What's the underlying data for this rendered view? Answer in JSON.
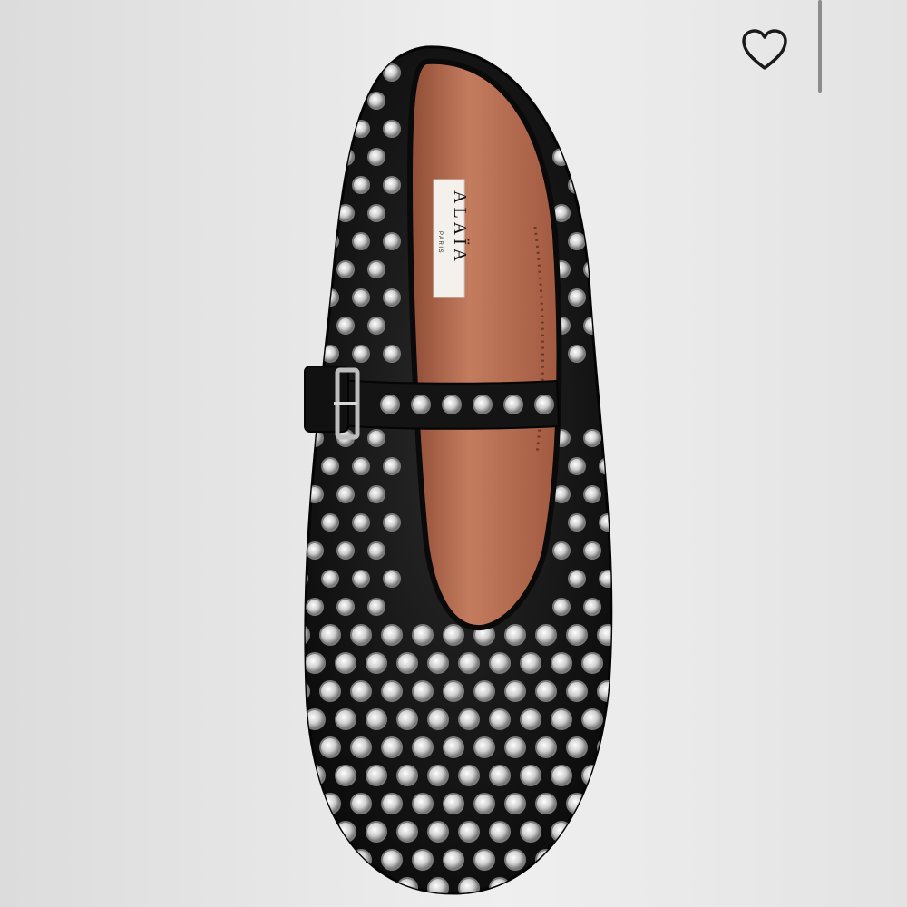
{
  "product": {
    "image_icon": "studded-mary-jane-flat-image",
    "brand_label": {
      "name": "ALAÏA",
      "subtitle": "PARIS"
    }
  },
  "controls": {
    "favorite_icon": "heart-outline-icon",
    "scrollbar": "vertical-scroll-indicator"
  },
  "colors": {
    "background": "#e9e9e9",
    "shoe_leather": "#151515",
    "lining": "#b06a4e",
    "studs": "#d9d9d9",
    "icon": "#1a1a1a"
  }
}
